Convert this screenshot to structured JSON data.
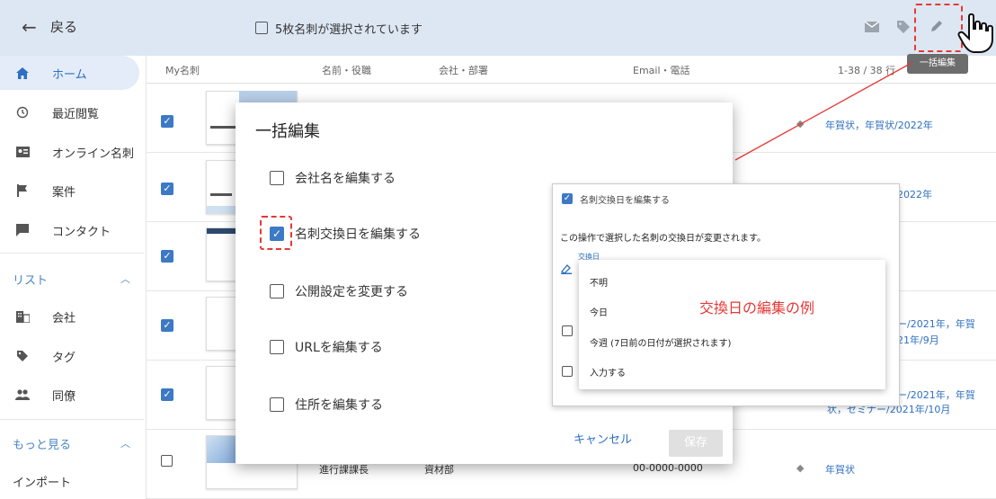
{
  "topbar": {
    "back_label": "戻る",
    "selection_label": "5枚名刺が選択されています",
    "bulk_edit_tooltip": "一括編集"
  },
  "sidebar": {
    "items": [
      {
        "label": "ホーム",
        "icon": "home-icon"
      },
      {
        "label": "最近閲覧",
        "icon": "history-icon"
      },
      {
        "label": "オンライン名刺",
        "icon": "contact-card-icon"
      },
      {
        "label": "案件",
        "icon": "flag-icon"
      },
      {
        "label": "コンタクト",
        "icon": "message-icon"
      }
    ],
    "section_list": "リスト",
    "list_items": [
      {
        "label": "会社",
        "icon": "building-icon"
      },
      {
        "label": "タグ",
        "icon": "tag-icon"
      },
      {
        "label": "同僚",
        "icon": "people-icon"
      }
    ],
    "section_more": "もっと見る",
    "more_items": [
      {
        "label": "インポート"
      }
    ]
  },
  "table": {
    "headers": {
      "my_card": "My名刺",
      "name": "名前・役職",
      "company": "会社・部署",
      "email": "Email・電話",
      "count": "1-38 / 38 行"
    },
    "rows": [
      {
        "checked": true,
        "tags": "年賀状，年賀状/2022年"
      },
      {
        "checked": true,
        "tags": "2022年"
      },
      {
        "checked": true,
        "tags": ""
      },
      {
        "checked": true,
        "tags": "ー/2021年，年賀",
        "tags2": "21年/9月"
      },
      {
        "checked": true,
        "tags": "ー/2021年，年賀",
        "tags2": "状，セミナー/2021年/10月"
      },
      {
        "checked": false,
        "tags": "年賀状",
        "name": "進行課課長",
        "company": "資材部",
        "phone": "00-0000-0000"
      }
    ]
  },
  "dialog": {
    "title": "一括編集",
    "options": [
      {
        "label": "会社名を編集する",
        "checked": false
      },
      {
        "label": "名刺交換日を編集する",
        "checked": true
      },
      {
        "label": "公開設定を変更する",
        "checked": false
      },
      {
        "label": "URLを編集する",
        "checked": false
      },
      {
        "label": "住所を編集する",
        "checked": false
      }
    ],
    "cancel_label": "キャンセル",
    "save_label": "保存"
  },
  "panel": {
    "check_label": "名刺交換日を編集する",
    "message": "この操作で選択した名刺の交換日が変更されます。",
    "date_label": "交換日",
    "menu_items": [
      "不明",
      "今日",
      "今週 (7日前の日付が選択されます)",
      "入力する"
    ]
  },
  "annotation": {
    "example_label": "交換日の編集の例",
    "color": "#e53935"
  },
  "colors": {
    "accent": "#3d79c4",
    "topbar_bg": "#dde7f3"
  }
}
